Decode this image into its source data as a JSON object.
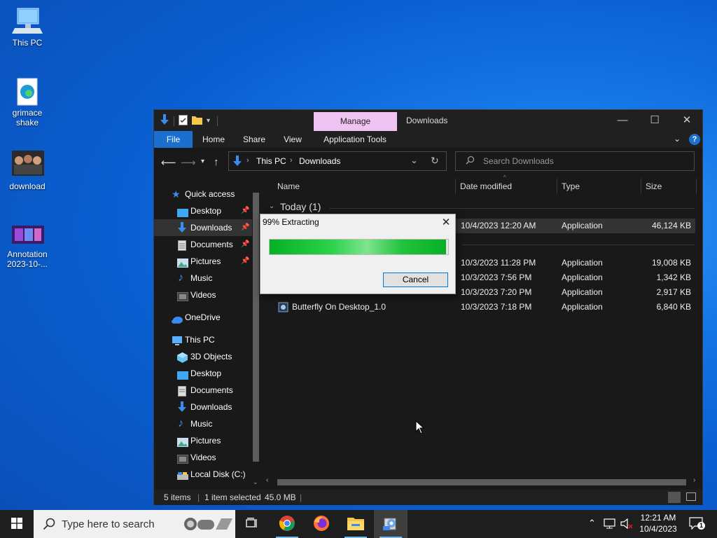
{
  "desktop": {
    "icons": [
      {
        "label": "This PC"
      },
      {
        "label": "grimace shake"
      },
      {
        "label": "download"
      },
      {
        "label": "Annotation 2023-10-..."
      }
    ]
  },
  "explorer": {
    "contextual_tab": "Manage",
    "title": "Downloads",
    "ribbon_tabs": [
      "File",
      "Home",
      "Share",
      "View",
      "Application Tools"
    ],
    "breadcrumb": [
      "This PC",
      "Downloads"
    ],
    "search_placeholder": "Search Downloads",
    "nav": {
      "quick_access": "Quick access",
      "quick_items": [
        "Desktop",
        "Downloads",
        "Documents",
        "Pictures",
        "Music",
        "Videos"
      ],
      "onedrive": "OneDrive",
      "this_pc": "This PC",
      "pc_items": [
        "3D Objects",
        "Desktop",
        "Documents",
        "Downloads",
        "Music",
        "Pictures",
        "Videos",
        "Local Disk (C:)"
      ]
    },
    "columns": [
      "Name",
      "Date modified",
      "Type",
      "Size"
    ],
    "group_today": "Today (1)",
    "rows": [
      {
        "name": "",
        "date": "10/4/2023 12:20 AM",
        "type": "Application",
        "size": "46,124 KB"
      },
      {
        "name": "",
        "date": "10/3/2023 11:28 PM",
        "type": "Application",
        "size": "19,008 KB"
      },
      {
        "name": "",
        "date": "10/3/2023 7:56 PM",
        "type": "Application",
        "size": "1,342 KB"
      },
      {
        "name": "",
        "date": "10/3/2023 7:20 PM",
        "type": "Application",
        "size": "2,917 KB"
      },
      {
        "name": "Butterfly On Desktop_1.0",
        "date": "10/3/2023 7:18 PM",
        "type": "Application",
        "size": "6,840 KB"
      }
    ],
    "status": {
      "items": "5 items",
      "selected": "1 item selected",
      "size": "45.0 MB"
    }
  },
  "dialog": {
    "title": "99% Extracting",
    "progress": 0.99,
    "cancel_label": "Cancel"
  },
  "taskbar": {
    "search_placeholder": "Type here to search",
    "time": "12:21 AM",
    "date": "10/4/2023",
    "notification_count": "1"
  },
  "colors": {
    "accent": "#1a6fd1",
    "manage_tab": "#f0c4f2",
    "progress_green": "#06b025"
  }
}
